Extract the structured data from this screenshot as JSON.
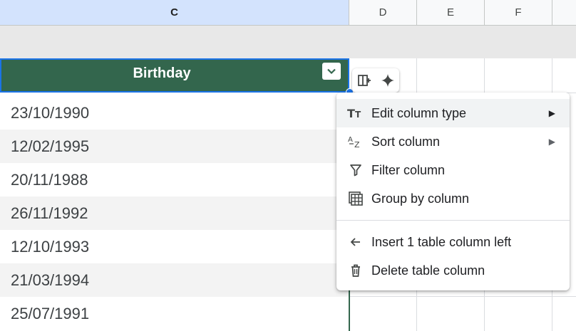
{
  "columns": [
    "C",
    "D",
    "E",
    "F"
  ],
  "table": {
    "header": "Birthday",
    "rows": [
      "23/10/1990",
      "12/02/1995",
      "20/11/1988",
      "26/11/1992",
      "12/10/1993",
      "21/03/1994",
      "25/07/1991"
    ]
  },
  "toolbar": {
    "icons": [
      "column-layout-icon",
      "sparkle-icon"
    ]
  },
  "menu": {
    "items": [
      {
        "label": "Edit column type",
        "icon": "text-type-icon",
        "submenu": true
      },
      {
        "label": "Sort column",
        "icon": "sort-az-icon",
        "submenu": true
      },
      {
        "label": "Filter column",
        "icon": "filter-icon",
        "submenu": false
      },
      {
        "label": "Group by column",
        "icon": "group-icon",
        "submenu": false
      },
      {
        "label": "Insert 1 table column left",
        "icon": "arrow-left-icon",
        "submenu": false
      },
      {
        "label": "Delete table column",
        "icon": "trash-icon",
        "submenu": false
      }
    ]
  },
  "colors": {
    "header_bg": "#33664d",
    "selected_col": "#d3e3fd",
    "selection": "#1a73e8"
  }
}
